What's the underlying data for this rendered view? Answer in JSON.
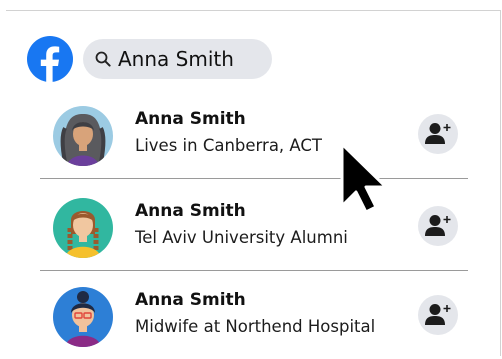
{
  "search": {
    "query": "Anna Smith"
  },
  "results": [
    {
      "name": "Anna Smith",
      "description": "Lives in Canberra, ACT"
    },
    {
      "name": "Anna Smith",
      "description": "Tel Aviv University Alumni"
    },
    {
      "name": "Anna Smith",
      "description": "Midwife at Northend Hospital"
    }
  ],
  "icons": {
    "logo": "facebook-logo",
    "search": "search-icon",
    "add_friend": "add-friend-icon",
    "cursor": "mouse-pointer"
  },
  "colors": {
    "brand": "#1877f2",
    "search_bg": "#e4e6eb",
    "button_bg": "#e4e6eb",
    "separator": "#9a9a9a"
  }
}
